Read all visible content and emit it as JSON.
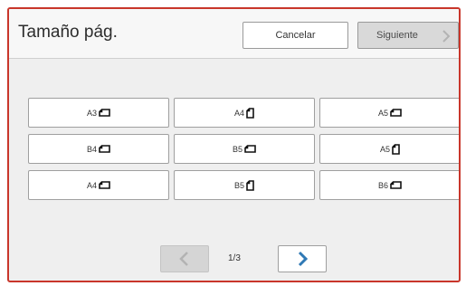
{
  "dialog": {
    "title": "Tamaño pág.",
    "cancel_label": "Cancelar",
    "next_label": "Siguiente"
  },
  "paper_sizes": [
    {
      "label": "A3",
      "orientation": "landscape"
    },
    {
      "label": "A4",
      "orientation": "portrait"
    },
    {
      "label": "A5",
      "orientation": "landscape"
    },
    {
      "label": "B4",
      "orientation": "landscape"
    },
    {
      "label": "B5",
      "orientation": "landscape"
    },
    {
      "label": "A5",
      "orientation": "portrait"
    },
    {
      "label": "A4",
      "orientation": "landscape"
    },
    {
      "label": "B5",
      "orientation": "portrait"
    },
    {
      "label": "B6",
      "orientation": "landscape"
    }
  ],
  "pagination": {
    "indicator": "1/3",
    "prev_enabled": false,
    "next_enabled": true
  },
  "colors": {
    "frame_accent": "#c9362b",
    "chevron_active": "#2f79b5",
    "chevron_disabled": "#b3b3b3"
  },
  "icons": {
    "landscape": "paper-landscape-icon",
    "portrait": "paper-portrait-icon",
    "next_page": "chevron-right-icon",
    "prev_page": "chevron-left-icon"
  }
}
